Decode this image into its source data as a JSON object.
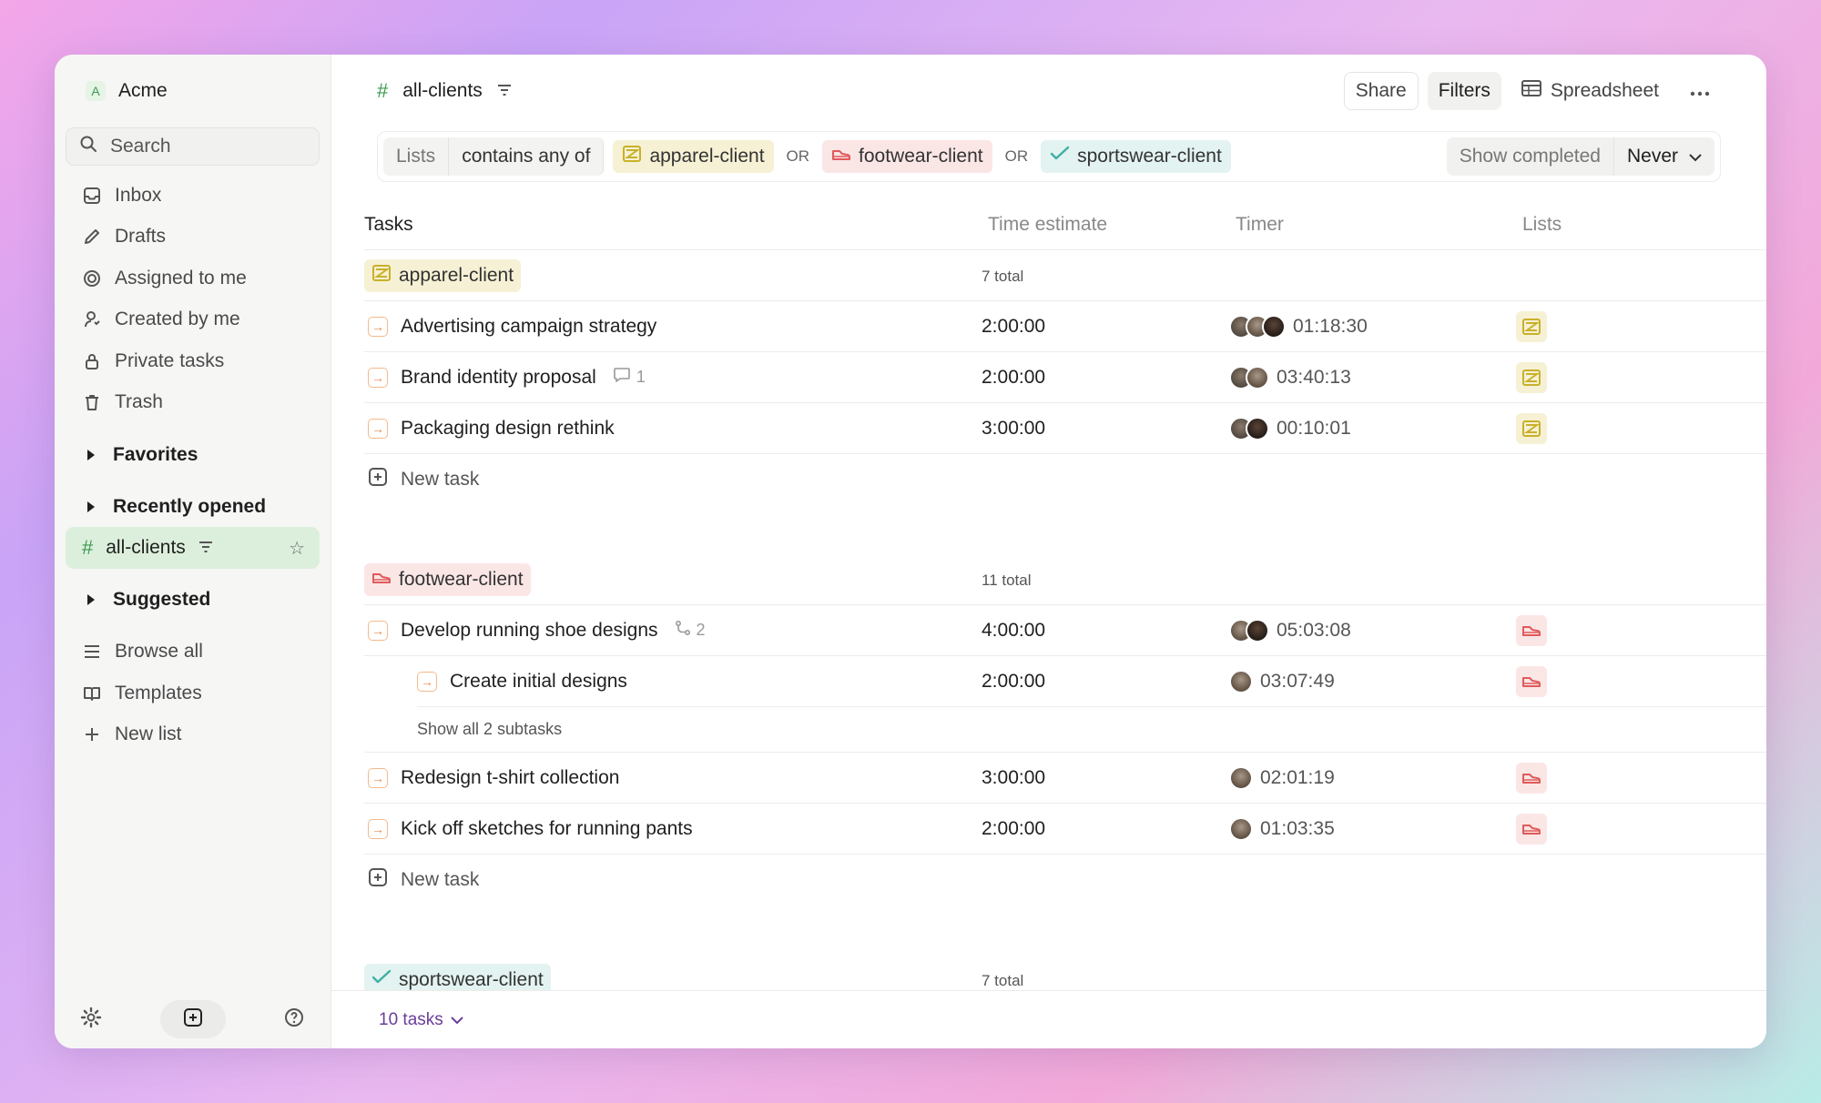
{
  "sidebar": {
    "workspace": {
      "badge": "A",
      "name": "Acme"
    },
    "search_label": "Search",
    "nav": [
      {
        "label": "Inbox",
        "icon": "inbox-icon"
      },
      {
        "label": "Drafts",
        "icon": "pencil-icon"
      },
      {
        "label": "Assigned to me",
        "icon": "target-icon"
      },
      {
        "label": "Created by me",
        "icon": "user-icon"
      },
      {
        "label": "Private tasks",
        "icon": "lock-icon"
      },
      {
        "label": "Trash",
        "icon": "trash-icon"
      }
    ],
    "favorites_label": "Favorites",
    "recent_label": "Recently opened",
    "active_list": "all-clients",
    "suggested_label": "Suggested",
    "bottom_nav": [
      {
        "label": "Browse all",
        "icon": "list-icon"
      },
      {
        "label": "Templates",
        "icon": "book-icon"
      },
      {
        "label": "New list",
        "icon": "plus-icon"
      }
    ]
  },
  "header": {
    "title": "all-clients",
    "share_label": "Share",
    "filters_label": "Filters",
    "spreadsheet_label": "Spreadsheet"
  },
  "filter": {
    "field": "Lists",
    "operator": "contains any of",
    "values": [
      "apparel-client",
      "footwear-client",
      "sportswear-client"
    ],
    "or_label": "OR",
    "show_completed_label": "Show completed",
    "show_completed_value": "Never"
  },
  "table": {
    "columns": [
      "Tasks",
      "Time estimate",
      "Timer",
      "Lists"
    ],
    "new_task_label": "New task",
    "groups": [
      {
        "name": "apparel-client",
        "total": "7 total",
        "tasks": [
          {
            "title": "Advertising campaign strategy",
            "estimate": "2:00:00",
            "timer": "01:18:30",
            "meta": ""
          },
          {
            "title": "Brand identity proposal",
            "estimate": "2:00:00",
            "timer": "03:40:13",
            "meta": "1"
          },
          {
            "title": "Packaging design rethink",
            "estimate": "3:00:00",
            "timer": "00:10:01",
            "meta": ""
          }
        ]
      },
      {
        "name": "footwear-client",
        "total": "11 total",
        "tasks": [
          {
            "title": "Develop running shoe designs",
            "estimate": "4:00:00",
            "timer": "05:03:08",
            "meta": "2"
          },
          {
            "title": "Create initial designs",
            "estimate": "2:00:00",
            "timer": "03:07:49",
            "meta": ""
          },
          {
            "title": "Redesign t-shirt collection",
            "estimate": "3:00:00",
            "timer": "02:01:19",
            "meta": ""
          },
          {
            "title": "Kick off sketches for running pants",
            "estimate": "2:00:00",
            "timer": "01:03:35",
            "meta": ""
          }
        ],
        "show_subtasks_label": "Show all 2 subtasks"
      },
      {
        "name": "sportswear-client",
        "total": "7 total"
      }
    ]
  },
  "footer": {
    "task_count": "10 tasks"
  },
  "colors": {
    "accent_green": "#3c9a4f",
    "apparel": "#c9b12a",
    "footwear": "#e05a5a",
    "sportswear": "#3fb0a3",
    "task_arrow": "#ea8a47"
  }
}
